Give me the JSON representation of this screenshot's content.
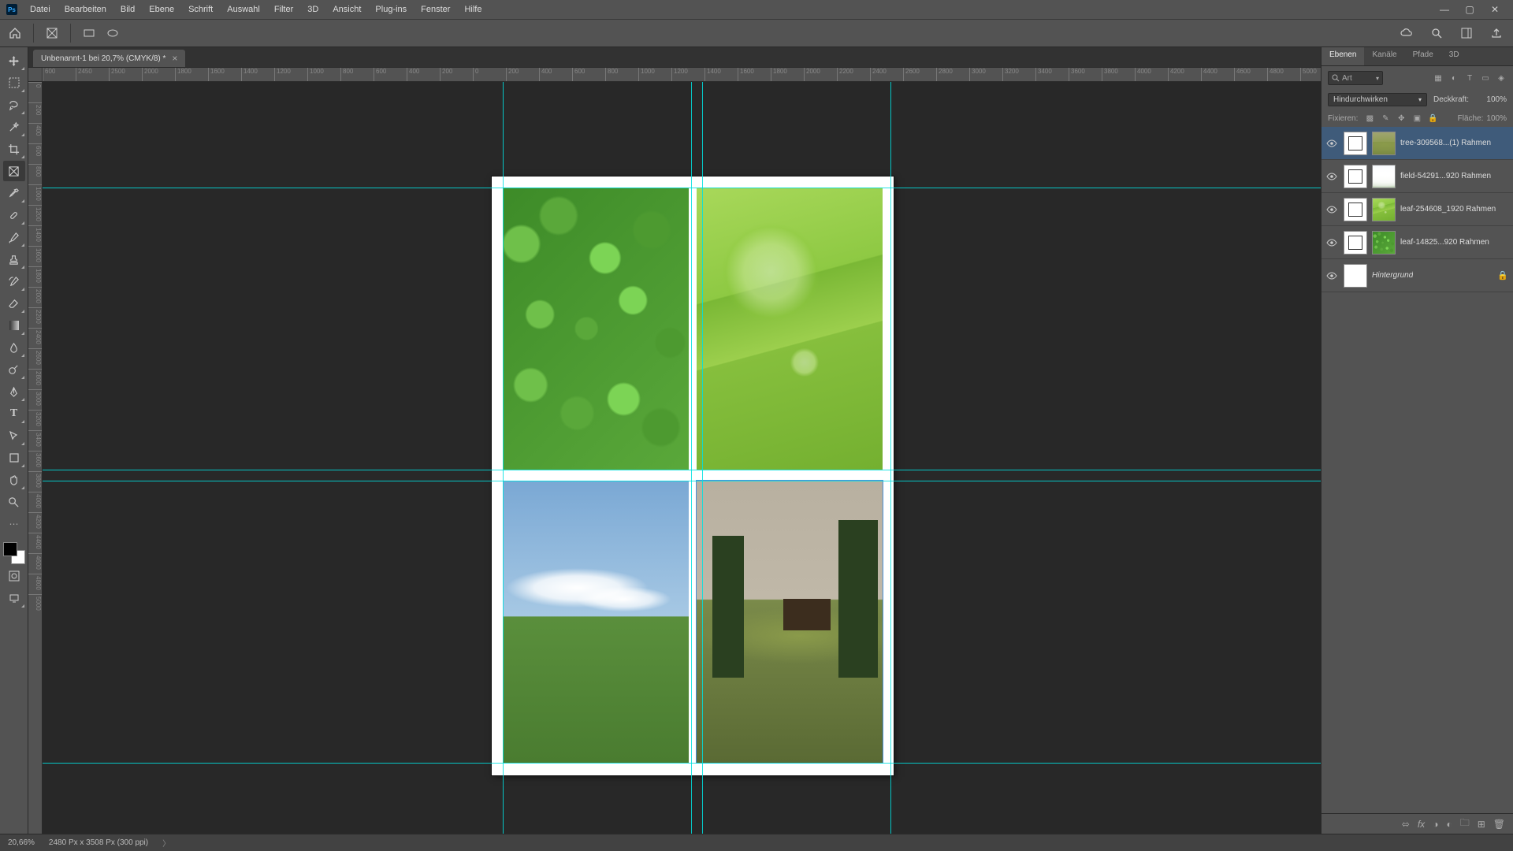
{
  "app": {
    "logo": "Ps"
  },
  "menu": [
    "Datei",
    "Bearbeiten",
    "Bild",
    "Ebene",
    "Schrift",
    "Auswahl",
    "Filter",
    "3D",
    "Ansicht",
    "Plug-ins",
    "Fenster",
    "Hilfe"
  ],
  "document": {
    "tab_title": "Unbenannt-1 bei 20,7% (CMYK/8) *"
  },
  "ruler_h": [
    "600",
    "2450",
    "2500",
    "2000",
    "1800",
    "1600",
    "1400",
    "1200",
    "1000",
    "800",
    "600",
    "400",
    "200",
    "0",
    "200",
    "400",
    "600",
    "800",
    "1000",
    "1200",
    "1400",
    "1600",
    "1800",
    "2000",
    "2200",
    "2400",
    "2600",
    "2800",
    "3000",
    "3200",
    "3400",
    "3600",
    "3800",
    "4000",
    "4200",
    "4400",
    "4600",
    "4800",
    "5000"
  ],
  "ruler_v": [
    "0",
    "200",
    "400",
    "600",
    "800",
    "1000",
    "1200",
    "1400",
    "1600",
    "1800",
    "2000",
    "2200",
    "2400",
    "2600",
    "2800",
    "3000",
    "3200",
    "3400",
    "3600",
    "3800",
    "4000",
    "4200",
    "4400",
    "4600",
    "4800",
    "5000"
  ],
  "panels": {
    "tabs": [
      "Ebenen",
      "Kanäle",
      "Pfade",
      "3D"
    ],
    "filter_label": "Art",
    "blend_mode": "Hindurchwirken",
    "opacity_label": "Deckkraft:",
    "opacity_value": "100%",
    "lock_label": "Fixieren:",
    "fill_label": "Fläche:",
    "fill_value": "100%"
  },
  "layers": [
    {
      "name": "tree-309568...(1) Rahmen",
      "thumb": "cabin",
      "selected": true
    },
    {
      "name": "field-54291...920 Rahmen",
      "thumb": "field",
      "selected": false
    },
    {
      "name": "leaf-254608_1920 Rahmen",
      "thumb": "leaf",
      "selected": false
    },
    {
      "name": "leaf-14825...920 Rahmen",
      "thumb": "clover",
      "selected": false
    },
    {
      "name": "Hintergrund",
      "thumb": "bg",
      "selected": false,
      "is_bg": true,
      "locked": true
    }
  ],
  "status": {
    "zoom": "20,66%",
    "info": "2480 Px x 3508 Px (300 ppi)"
  }
}
